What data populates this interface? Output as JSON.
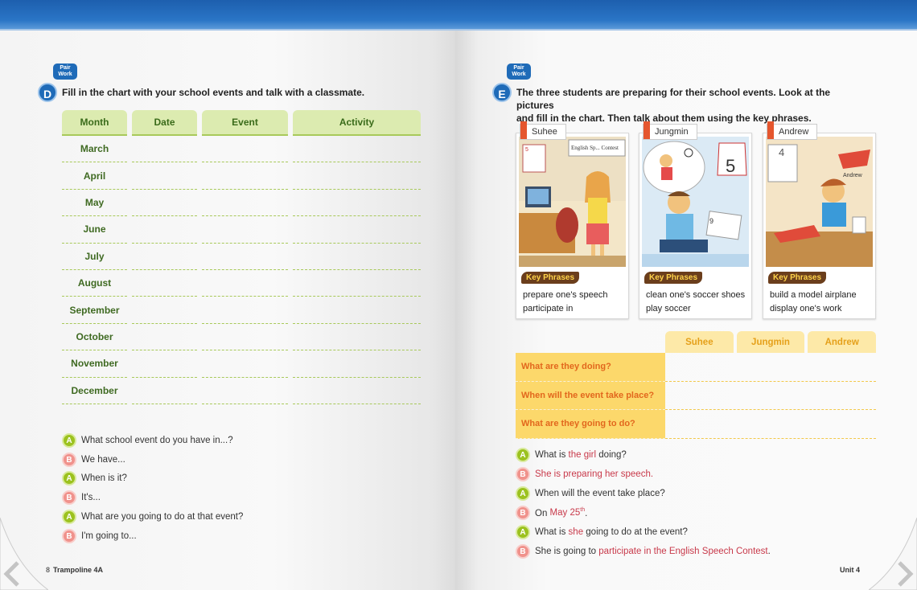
{
  "left": {
    "pair_work": "Pair Work",
    "section_letter": "D",
    "instruction": "Fill in the chart with your school events and talk with a classmate.",
    "table_headers": [
      "Month",
      "Date",
      "Event",
      "Activity"
    ],
    "months": [
      "March",
      "April",
      "May",
      "June",
      "July",
      "August",
      "September",
      "October",
      "November",
      "December"
    ],
    "dialogue": [
      {
        "speaker": "A",
        "text": "What school event do you have in...?"
      },
      {
        "speaker": "B",
        "text": "We have..."
      },
      {
        "speaker": "A",
        "text": "When is it?"
      },
      {
        "speaker": "B",
        "text": "It's..."
      },
      {
        "speaker": "A",
        "text": "What are you going to do at that event?"
      },
      {
        "speaker": "B",
        "text": "I'm going to..."
      }
    ],
    "footer": "Trampoline 4A",
    "page_num": "8"
  },
  "right": {
    "pair_work": "Pair Work",
    "section_letter": "E",
    "instruction_1": "The three students are preparing for their school events. Look at the pictures",
    "instruction_2": "and fill in the chart. Then talk about them using the key phrases.",
    "key_phrases_label": "Key Phrases",
    "cards": [
      {
        "name": "Suhee",
        "phrase_1": "prepare one's speech",
        "phrase_2": "participate in",
        "picture_text": "English Sp... Contest",
        "calendar_num": "5"
      },
      {
        "name": "Jungmin",
        "phrase_1": "clean one's soccer shoes",
        "phrase_2": "play soccer",
        "picture_text": "5",
        "calendar_num": "9"
      },
      {
        "name": "Andrew",
        "phrase_1": "build a model airplane",
        "phrase_2": "display one's work",
        "picture_text": "Andrew",
        "calendar_num": "4"
      }
    ],
    "table_headers": [
      "Suhee",
      "Jungmin",
      "Andrew"
    ],
    "questions": [
      "What are they doing?",
      "When will the event take place?",
      "What are they going to do?"
    ],
    "footer": "Unit 4",
    "colors": {
      "accent_red": "#c8394a",
      "header_blue": "#1f6bb8",
      "green_head": "#dcebb0",
      "yellow_q": "#fcd86b"
    }
  }
}
